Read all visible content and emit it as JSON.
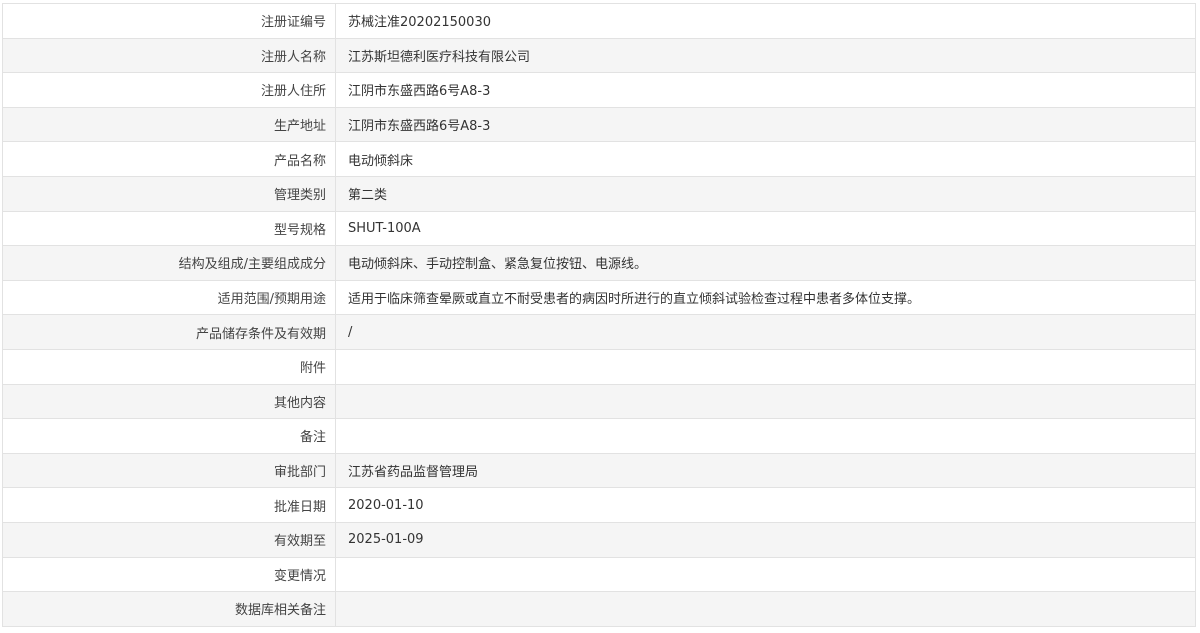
{
  "rows": [
    {
      "label": "注册证编号",
      "value": "苏械注准20202150030"
    },
    {
      "label": "注册人名称",
      "value": "江苏斯坦德利医疗科技有限公司"
    },
    {
      "label": "注册人住所",
      "value": "江阴市东盛西路6号A8-3"
    },
    {
      "label": "生产地址",
      "value": "江阴市东盛西路6号A8-3"
    },
    {
      "label": "产品名称",
      "value": "电动倾斜床"
    },
    {
      "label": "管理类别",
      "value": "第二类"
    },
    {
      "label": "型号规格",
      "value": "SHUT-100A"
    },
    {
      "label": "结构及组成/主要组成成分",
      "value": "电动倾斜床、手动控制盒、紧急复位按钮、电源线。"
    },
    {
      "label": "适用范围/预期用途",
      "value": "适用于临床筛查晕厥或直立不耐受患者的病因时所进行的直立倾斜试验检查过程中患者多体位支撑。"
    },
    {
      "label": "产品储存条件及有效期",
      "value": "/"
    },
    {
      "label": "附件",
      "value": ""
    },
    {
      "label": "其他内容",
      "value": ""
    },
    {
      "label": "备注",
      "value": ""
    },
    {
      "label": "审批部门",
      "value": "江苏省药品监督管理局"
    },
    {
      "label": "批准日期",
      "value": "2020-01-10"
    },
    {
      "label": "有效期至",
      "value": "2025-01-09"
    },
    {
      "label": "变更情况",
      "value": ""
    },
    {
      "label": "数据库相关备注",
      "value": ""
    }
  ]
}
